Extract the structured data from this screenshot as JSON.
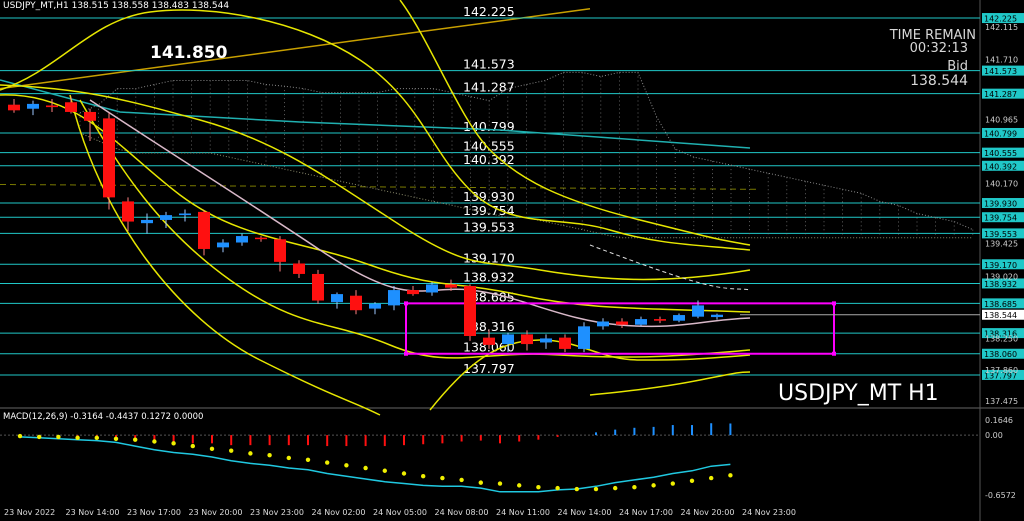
{
  "header": {
    "symbol_tf": "USDJPY_MT,H1",
    "ohlc": "138.515 138.558 138.483 138.544"
  },
  "info": {
    "time_remain_label": "TIME REMAIN",
    "time_remain": "00:32:13",
    "bid_label": "Bid",
    "bid": "138.544",
    "big_level": "141.850"
  },
  "watermark": "USDJPY_MT H1",
  "macd_header": "MACD(12,26,9) -0.3164 -0.4437 0.1272 0.0000",
  "colors": {
    "background": "#000000",
    "level_line": "#20c8c8",
    "bull": "#1e90ff",
    "bear": "#ff1010",
    "bands": "#e6e600",
    "box": "#ff00ff",
    "gold_trend": "#c8a000",
    "signal_dots": "#f0f000"
  },
  "chart_data": [
    {
      "type": "candlestick",
      "title": "USDJPY_MT,H1",
      "ylim": [
        137.3,
        142.3
      ],
      "grid": false,
      "price_axis": [
        "142.115",
        "141.710",
        "140.965",
        "140.170",
        "139.425",
        "139.020",
        "138.250",
        "137.860",
        "137.475"
      ],
      "x_labels": [
        "23 Nov 2022",
        "23 Nov 14:00",
        "23 Nov 17:00",
        "23 Nov 20:00",
        "23 Nov 23:00",
        "24 Nov 02:00",
        "24 Nov 05:00",
        "24 Nov 08:00",
        "24 Nov 11:00",
        "24 Nov 14:00",
        "24 Nov 17:00",
        "24 Nov 20:00",
        "24 Nov 23:00"
      ],
      "levels": [
        {
          "label": "142.225",
          "value": 142.225
        },
        {
          "label": "141.573",
          "value": 141.573
        },
        {
          "label": "141.287",
          "value": 141.287
        },
        {
          "label": "140.799",
          "value": 140.799
        },
        {
          "label": "140.555",
          "value": 140.555
        },
        {
          "label": "140.392",
          "value": 140.392
        },
        {
          "label": "139.930",
          "value": 139.93
        },
        {
          "label": "139.754",
          "value": 139.754
        },
        {
          "label": "139.553",
          "value": 139.553
        },
        {
          "label": "139.170",
          "value": 139.17
        },
        {
          "label": "138.932",
          "value": 138.932
        },
        {
          "label": "138.685",
          "value": 138.685
        },
        {
          "label": "138.316",
          "value": 138.316
        },
        {
          "label": "138.060",
          "value": 138.06
        },
        {
          "label": "137.797",
          "value": 137.797
        }
      ],
      "current_price": {
        "label": "138.544",
        "value": 138.544
      },
      "candles": [
        {
          "o": 141.15,
          "h": 141.22,
          "l": 141.05,
          "c": 141.08
        },
        {
          "o": 141.1,
          "h": 141.2,
          "l": 141.02,
          "c": 141.16
        },
        {
          "o": 141.14,
          "h": 141.22,
          "l": 141.06,
          "c": 141.12
        },
        {
          "o": 141.18,
          "h": 141.25,
          "l": 141.04,
          "c": 141.06
        },
        {
          "o": 141.06,
          "h": 141.1,
          "l": 140.7,
          "c": 140.95
        },
        {
          "o": 140.98,
          "h": 141.05,
          "l": 139.85,
          "c": 140.0
        },
        {
          "o": 139.95,
          "h": 140.0,
          "l": 139.58,
          "c": 139.7
        },
        {
          "o": 139.68,
          "h": 139.8,
          "l": 139.55,
          "c": 139.72
        },
        {
          "o": 139.72,
          "h": 139.82,
          "l": 139.62,
          "c": 139.78
        },
        {
          "o": 139.78,
          "h": 139.85,
          "l": 139.7,
          "c": 139.8
        },
        {
          "o": 139.82,
          "h": 139.84,
          "l": 139.28,
          "c": 139.36
        },
        {
          "o": 139.38,
          "h": 139.48,
          "l": 139.32,
          "c": 139.44
        },
        {
          "o": 139.44,
          "h": 139.55,
          "l": 139.4,
          "c": 139.52
        },
        {
          "o": 139.5,
          "h": 139.52,
          "l": 139.45,
          "c": 139.49
        },
        {
          "o": 139.48,
          "h": 139.52,
          "l": 139.08,
          "c": 139.2
        },
        {
          "o": 139.18,
          "h": 139.22,
          "l": 139.0,
          "c": 139.05
        },
        {
          "o": 139.05,
          "h": 139.1,
          "l": 138.68,
          "c": 138.72
        },
        {
          "o": 138.7,
          "h": 138.82,
          "l": 138.62,
          "c": 138.8
        },
        {
          "o": 138.78,
          "h": 138.85,
          "l": 138.55,
          "c": 138.6
        },
        {
          "o": 138.62,
          "h": 138.7,
          "l": 138.55,
          "c": 138.68
        },
        {
          "o": 138.66,
          "h": 138.9,
          "l": 138.6,
          "c": 138.85
        },
        {
          "o": 138.85,
          "h": 138.9,
          "l": 138.78,
          "c": 138.8
        },
        {
          "o": 138.82,
          "h": 138.95,
          "l": 138.78,
          "c": 138.92
        },
        {
          "o": 138.92,
          "h": 138.98,
          "l": 138.84,
          "c": 138.88
        },
        {
          "o": 138.9,
          "h": 138.92,
          "l": 138.22,
          "c": 138.28
        },
        {
          "o": 138.26,
          "h": 138.36,
          "l": 138.12,
          "c": 138.17
        },
        {
          "o": 138.18,
          "h": 138.32,
          "l": 138.08,
          "c": 138.3
        },
        {
          "o": 138.3,
          "h": 138.35,
          "l": 138.1,
          "c": 138.18
        },
        {
          "o": 138.2,
          "h": 138.3,
          "l": 138.12,
          "c": 138.25
        },
        {
          "o": 138.26,
          "h": 138.3,
          "l": 138.08,
          "c": 138.12
        },
        {
          "o": 138.12,
          "h": 138.45,
          "l": 138.08,
          "c": 138.4
        },
        {
          "o": 138.4,
          "h": 138.5,
          "l": 138.36,
          "c": 138.46
        },
        {
          "o": 138.46,
          "h": 138.5,
          "l": 138.38,
          "c": 138.42
        },
        {
          "o": 138.42,
          "h": 138.52,
          "l": 138.4,
          "c": 138.49
        },
        {
          "o": 138.49,
          "h": 138.52,
          "l": 138.44,
          "c": 138.47
        },
        {
          "o": 138.47,
          "h": 138.56,
          "l": 138.45,
          "c": 138.54
        },
        {
          "o": 138.52,
          "h": 138.72,
          "l": 138.5,
          "c": 138.66
        },
        {
          "o": 138.515,
          "h": 138.558,
          "l": 138.483,
          "c": 138.544
        }
      ]
    },
    {
      "type": "macd",
      "title": "MACD(12,26,9) -0.3164 -0.4437 0.1272 0.0000",
      "ylim": [
        -0.71,
        0.22
      ],
      "axis": [
        "0.1646",
        "0.00",
        "-0.6572"
      ],
      "macd_line": [
        -0.02,
        -0.03,
        -0.04,
        -0.05,
        -0.06,
        -0.08,
        -0.12,
        -0.16,
        -0.19,
        -0.21,
        -0.24,
        -0.28,
        -0.31,
        -0.33,
        -0.36,
        -0.38,
        -0.42,
        -0.45,
        -0.48,
        -0.51,
        -0.53,
        -0.55,
        -0.56,
        -0.56,
        -0.58,
        -0.62,
        -0.62,
        -0.62,
        -0.6,
        -0.59,
        -0.56,
        -0.52,
        -0.49,
        -0.46,
        -0.42,
        -0.39,
        -0.34,
        -0.32
      ],
      "signal": [
        -0.01,
        -0.02,
        -0.02,
        -0.03,
        -0.03,
        -0.04,
        -0.05,
        -0.07,
        -0.09,
        -0.12,
        -0.15,
        -0.17,
        -0.2,
        -0.22,
        -0.25,
        -0.27,
        -0.3,
        -0.33,
        -0.36,
        -0.39,
        -0.42,
        -0.45,
        -0.47,
        -0.49,
        -0.52,
        -0.53,
        -0.55,
        -0.57,
        -0.58,
        -0.59,
        -0.59,
        -0.58,
        -0.57,
        -0.55,
        -0.53,
        -0.5,
        -0.47,
        -0.44
      ],
      "histogram": [
        -0.01,
        -0.01,
        -0.02,
        -0.02,
        -0.03,
        -0.04,
        -0.07,
        -0.09,
        -0.1,
        -0.09,
        -0.09,
        -0.11,
        -0.11,
        -0.11,
        -0.11,
        -0.11,
        -0.12,
        -0.12,
        -0.12,
        -0.12,
        -0.11,
        -0.1,
        -0.09,
        -0.07,
        -0.06,
        -0.09,
        -0.07,
        -0.05,
        -0.02,
        0.0,
        0.03,
        0.06,
        0.08,
        0.09,
        0.11,
        0.11,
        0.13,
        0.1272
      ]
    }
  ]
}
